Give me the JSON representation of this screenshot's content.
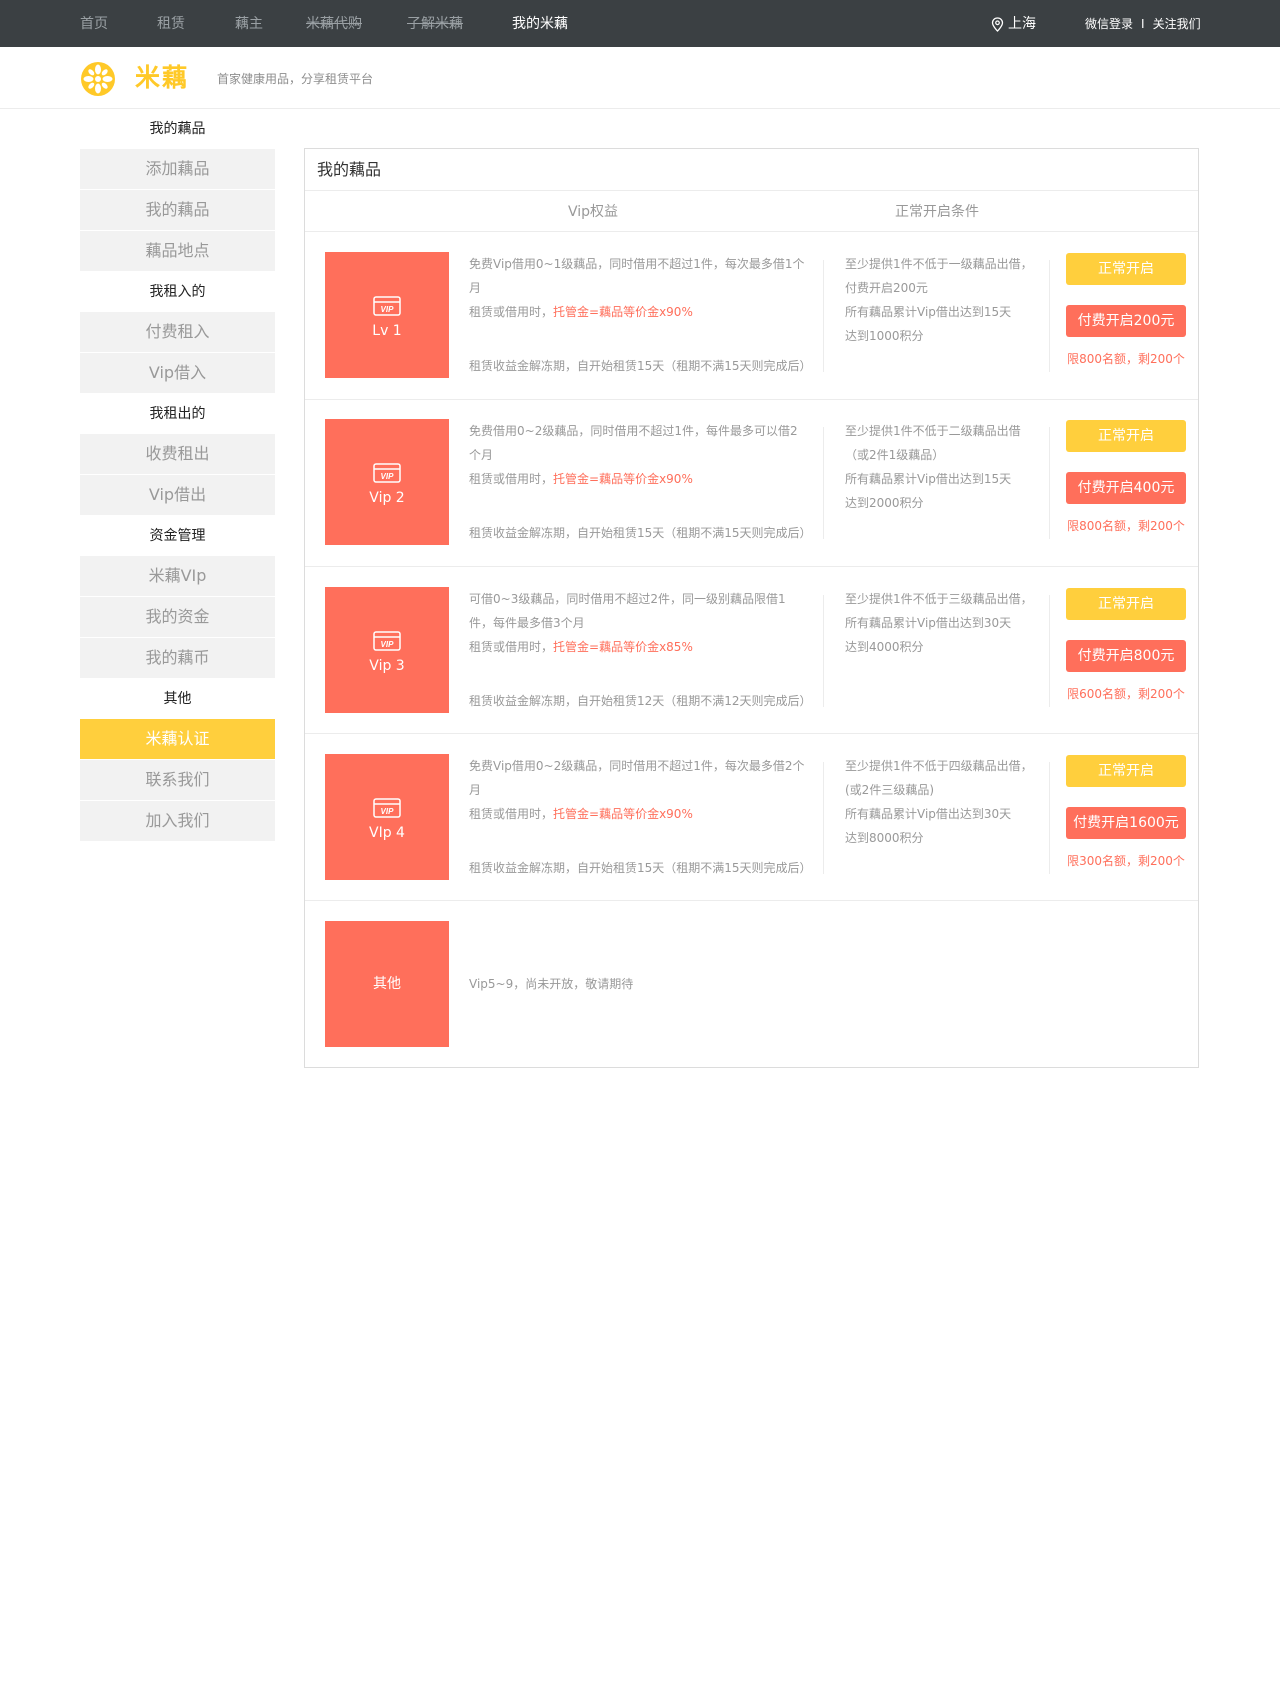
{
  "topnav": {
    "items": [
      "首页",
      "租赁",
      "藕主",
      "米藕代购",
      "了解米藕",
      "我的米藕"
    ],
    "location": "上海",
    "login": "微信登录",
    "separator": "I",
    "follow": "关注我们"
  },
  "header": {
    "brand": "米藕",
    "tagline": "首家健康用品，分享租赁平台"
  },
  "sidebar": {
    "groups": [
      {
        "title": "我的藕品",
        "items": [
          "添加藕品",
          "我的藕品",
          "藕品地点"
        ]
      },
      {
        "title": "我租入的",
        "items": [
          "付费租入",
          "Vip借入"
        ]
      },
      {
        "title": "我租出的",
        "items": [
          "收费租出",
          "Vip借出"
        ]
      },
      {
        "title": "资金管理",
        "items": [
          "米藕VIp",
          "我的资金",
          "我的藕币"
        ]
      },
      {
        "title": "其他",
        "items": [
          "米藕认证",
          "联系我们",
          "加入我们"
        ]
      }
    ],
    "active_item": "米藕认证"
  },
  "panel": {
    "title": "我的藕品",
    "col_benefits": "Vip权益",
    "col_conditions": "正常开启条件",
    "rows": [
      {
        "badge_icon_text": "VIP",
        "level": "Lv 1",
        "benefit_1": "免费Vip借用0~1级藕品，同时借用不超过1件，每次最多借1个月",
        "benefit_2_prefix": "租赁或借用时，",
        "benefit_2_highlight": "托管金=藕品等价金x90%",
        "benefit_3": "租赁收益金解冻期，自开始租赁15天（租期不满15天则完成后）",
        "conditions": [
          "至少提供1件不低于一级藕品出借，",
          "付费开启200元",
          "所有藕品累计Vip借出达到15天",
          "达到1000积分"
        ],
        "btn_normal": "正常开启",
        "btn_pay": "付费开启200元",
        "limit": "限800名额，剩200个"
      },
      {
        "badge_icon_text": "VIP",
        "level": "Vip 2",
        "benefit_1": "免费借用0~2级藕品，同时借用不超过1件，每件最多可以借2个月",
        "benefit_2_prefix": "租赁或借用时，",
        "benefit_2_highlight": "托管金=藕品等价金x90%",
        "benefit_3": "租赁收益金解冻期，自开始租赁15天（租期不满15天则完成后）",
        "conditions": [
          "至少提供1件不低于二级藕品出借",
          "（或2件1级藕品）",
          "所有藕品累计Vip借出达到15天",
          "达到2000积分"
        ],
        "btn_normal": "正常开启",
        "btn_pay": "付费开启400元",
        "limit": "限800名额，剩200个"
      },
      {
        "badge_icon_text": "VIP",
        "level": "Vip 3",
        "benefit_1": "可借0~3级藕品，同时借用不超过2件，同一级别藕品限借1件，每件最多借3个月",
        "benefit_2_prefix": "租赁或借用时，",
        "benefit_2_highlight": "托管金=藕品等价金x85%",
        "benefit_3": "租赁收益金解冻期，自开始租赁12天（租期不满12天则完成后）",
        "conditions": [
          "至少提供1件不低于三级藕品出借，",
          "所有藕品累计Vip借出达到30天",
          "达到4000积分"
        ],
        "btn_normal": "正常开启",
        "btn_pay": "付费开启800元",
        "limit": "限600名额，剩200个"
      },
      {
        "badge_icon_text": "VIP",
        "level": "VIp 4",
        "benefit_1": "免费Vip借用0~2级藕品，同时借用不超过1件，每次最多借2个月",
        "benefit_2_prefix": "租赁或借用时，",
        "benefit_2_highlight": "托管金=藕品等价金x90%",
        "benefit_3": "租赁收益金解冻期，自开始租赁15天（租期不满15天则完成后）",
        "conditions": [
          "至少提供1件不低于四级藕品出借，",
          "(或2件三级藕品)",
          "所有藕品累计Vip借出达到30天",
          "达到8000积分"
        ],
        "btn_normal": "正常开启",
        "btn_pay": "付费开启1600元",
        "limit": "限300名额，剩200个"
      }
    ],
    "other": {
      "label": "其他",
      "text": "Vip5~9，尚未开放，敬请期待"
    }
  },
  "colors": {
    "topnav_bg": "#3b4043",
    "accent_yellow": "#ffcf3d",
    "accent_red": "#ff6f5b",
    "sidebar_item_bg": "#f2f2f2"
  }
}
